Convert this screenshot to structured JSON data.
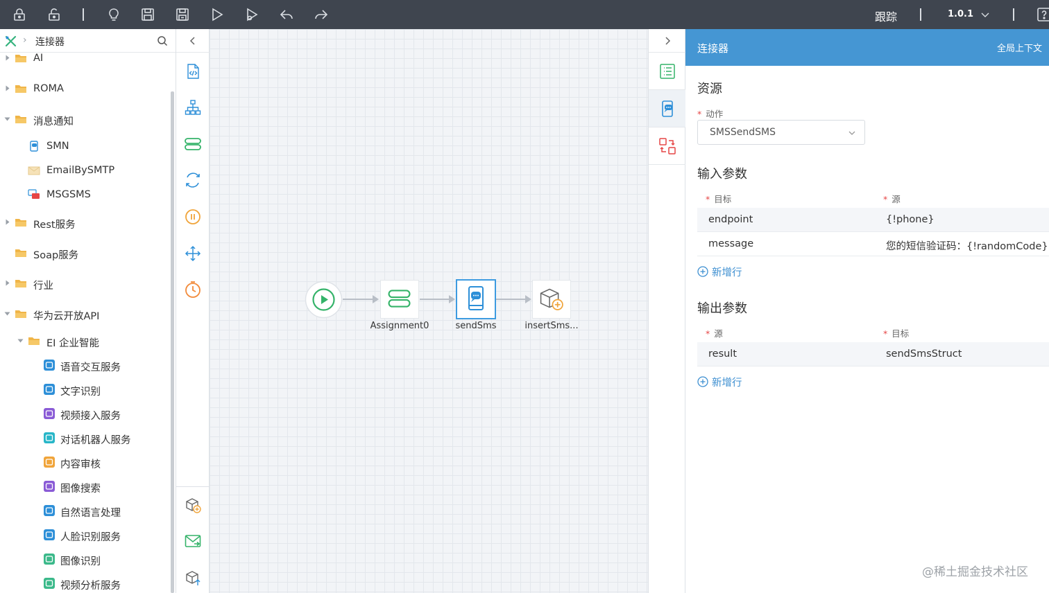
{
  "toolbar": {
    "icons": [
      "lock-icon",
      "unlock-icon",
      "bulb-icon",
      "save-icon",
      "save-as-icon",
      "run-icon",
      "debug-icon",
      "undo-icon",
      "redo-icon"
    ],
    "trace_label": "跟踪",
    "version": "1.0.1"
  },
  "left_panel": {
    "breadcrumb_title": "连接器",
    "tree": [
      {
        "label": "AI",
        "level": 0,
        "expandable": true,
        "expanded": false,
        "icon": "folder-icon"
      },
      {
        "label": "ROMA",
        "level": 0,
        "expandable": true,
        "expanded": false,
        "icon": "folder-icon"
      },
      {
        "label": "消息通知",
        "level": 0,
        "expandable": true,
        "expanded": true,
        "icon": "folder-icon"
      },
      {
        "label": "SMN",
        "level": 1,
        "expandable": false,
        "icon": "smn-icon"
      },
      {
        "label": "EmailBySMTP",
        "level": 1,
        "expandable": false,
        "icon": "email-icon"
      },
      {
        "label": "MSGSMS",
        "level": 1,
        "expandable": false,
        "icon": "sms-icon"
      },
      {
        "label": "Rest服务",
        "level": 0,
        "expandable": true,
        "expanded": false,
        "icon": "folder-icon"
      },
      {
        "label": "Soap服务",
        "level": 0,
        "expandable": false,
        "icon": "folder-icon"
      },
      {
        "label": "行业",
        "level": 0,
        "expandable": true,
        "expanded": false,
        "icon": "folder-icon"
      },
      {
        "label": "华为云开放API",
        "level": 0,
        "expandable": true,
        "expanded": true,
        "icon": "folder-icon"
      },
      {
        "label": "EI 企业智能",
        "level": 1,
        "expandable": true,
        "expanded": true,
        "icon": "folder-icon"
      },
      {
        "label": "语音交互服务",
        "level": 2,
        "expandable": false,
        "icon": "service-icon",
        "color": "#2d8fd8"
      },
      {
        "label": "文字识别",
        "level": 2,
        "expandable": false,
        "icon": "service-icon",
        "color": "#2d8fd8"
      },
      {
        "label": "视频接入服务",
        "level": 2,
        "expandable": false,
        "icon": "service-icon",
        "color": "#8a5bd6"
      },
      {
        "label": "对话机器人服务",
        "level": 2,
        "expandable": false,
        "icon": "service-icon",
        "color": "#28b6c8"
      },
      {
        "label": "内容审核",
        "level": 2,
        "expandable": false,
        "icon": "service-icon",
        "color": "#f0a43a"
      },
      {
        "label": "图像搜索",
        "level": 2,
        "expandable": false,
        "icon": "service-icon",
        "color": "#8a5bd6"
      },
      {
        "label": "自然语言处理",
        "level": 2,
        "expandable": false,
        "icon": "service-icon",
        "color": "#2d8fd8"
      },
      {
        "label": "人脸识别服务",
        "level": 2,
        "expandable": false,
        "icon": "service-icon",
        "color": "#2d8fd8"
      },
      {
        "label": "图像识别",
        "level": 2,
        "expandable": false,
        "icon": "service-icon",
        "color": "#3bb98a"
      },
      {
        "label": "视频分析服务",
        "level": 2,
        "expandable": false,
        "icon": "service-icon",
        "color": "#3bb98a"
      }
    ]
  },
  "palette": {
    "tools": [
      "script-icon",
      "org-chart-icon",
      "assignment-icon",
      "loop-icon",
      "pause-icon",
      "fork-icon",
      "timer-icon"
    ],
    "bottom_tools": [
      "insert-record-icon",
      "mail-icon",
      "upload-object-icon"
    ]
  },
  "canvas": {
    "nodes": [
      {
        "id": "start",
        "label": "",
        "icon": "play-icon"
      },
      {
        "id": "assignment0",
        "label": "Assignment0",
        "icon": "assignment-icon"
      },
      {
        "id": "sendsms",
        "label": "sendSms",
        "icon": "sms-connector-icon",
        "selected": true
      },
      {
        "id": "insertsms",
        "label": "insertSms...",
        "icon": "insert-record-icon"
      }
    ]
  },
  "side_tabs": [
    "list-icon",
    "connector-tab-icon",
    "mapping-icon"
  ],
  "properties": {
    "header_title": "连接器",
    "header_right": "全局上下文",
    "resource_title": "资源",
    "action_label": "动作",
    "action_value": "SMSSendSMS",
    "input_title": "输入参数",
    "input_col_target": "目标",
    "input_col_source": "源",
    "input_rows": [
      {
        "target": "endpoint",
        "source": "{!phone}"
      },
      {
        "target": "message",
        "source": "您的短信验证码：{!randomCode}"
      }
    ],
    "add_row_label": "新增行",
    "output_title": "输出参数",
    "output_col_source": "源",
    "output_col_target": "目标",
    "output_rows": [
      {
        "source": "result",
        "target": "sendSmsStruct"
      }
    ],
    "add_row_label_2": "新增行"
  },
  "watermark": "@稀土掘金技术社区",
  "colors": {
    "toolbar_bg": "#3f454f",
    "accent": "#4596d3",
    "link": "#3d8fd1",
    "folder": "#f0b548",
    "required": "#e64545"
  }
}
